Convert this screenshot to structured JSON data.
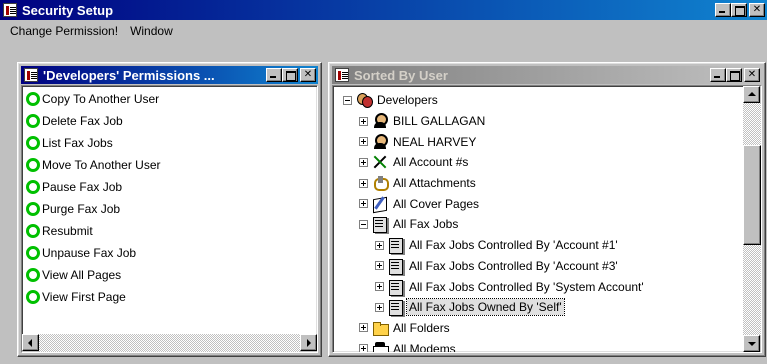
{
  "app": {
    "title": "Security Setup"
  },
  "menu": {
    "items": [
      "Change Permission!",
      "Window"
    ]
  },
  "left_window": {
    "title": "'Developers' Permissions ...",
    "permissions": [
      "Copy To Another User",
      "Delete Fax Job",
      "List Fax Jobs",
      "Move To Another User",
      "Pause Fax Job",
      "Purge Fax Job",
      "Resubmit",
      "Unpause Fax Job",
      "View All Pages",
      "View First Page"
    ]
  },
  "right_window": {
    "title": "Sorted By User",
    "tree": [
      {
        "label": "Developers",
        "icon": "group-icon",
        "expander": "minus",
        "indent": 0
      },
      {
        "label": "BILL GALLAGAN",
        "icon": "user-icon",
        "expander": "plus",
        "indent": 1
      },
      {
        "label": "NEAL HARVEY",
        "icon": "user-icon",
        "expander": "plus",
        "indent": 1
      },
      {
        "label": "All Account #s",
        "icon": "account-icon",
        "expander": "plus",
        "indent": 1
      },
      {
        "label": "All Attachments",
        "icon": "attachment-icon",
        "expander": "plus",
        "indent": 1
      },
      {
        "label": "All Cover Pages",
        "icon": "cover-page-icon",
        "expander": "plus",
        "indent": 1
      },
      {
        "label": "All Fax Jobs",
        "icon": "fax-jobs-icon",
        "expander": "minus",
        "indent": 1
      },
      {
        "label": "All Fax Jobs Controlled By 'Account #1'",
        "icon": "fax-jobs-icon",
        "expander": "plus",
        "indent": 2
      },
      {
        "label": "All Fax Jobs Controlled By 'Account #3'",
        "icon": "fax-jobs-icon",
        "expander": "plus",
        "indent": 2
      },
      {
        "label": "All Fax Jobs Controlled By 'System Account'",
        "icon": "fax-jobs-icon",
        "expander": "plus",
        "indent": 2
      },
      {
        "label": "All Fax Jobs Owned By 'Self'",
        "icon": "fax-jobs-icon",
        "expander": "plus",
        "indent": 2,
        "selected": true
      },
      {
        "label": "All Folders",
        "icon": "folder-icon",
        "expander": "plus",
        "indent": 1
      },
      {
        "label": "All Modems",
        "icon": "modem-icon",
        "expander": "plus",
        "indent": 1
      }
    ]
  },
  "colors": {
    "active_title_start": "#000080",
    "active_title_end": "#1084d0",
    "inactive_title_start": "#808080",
    "permission_ring": "#00c000"
  }
}
